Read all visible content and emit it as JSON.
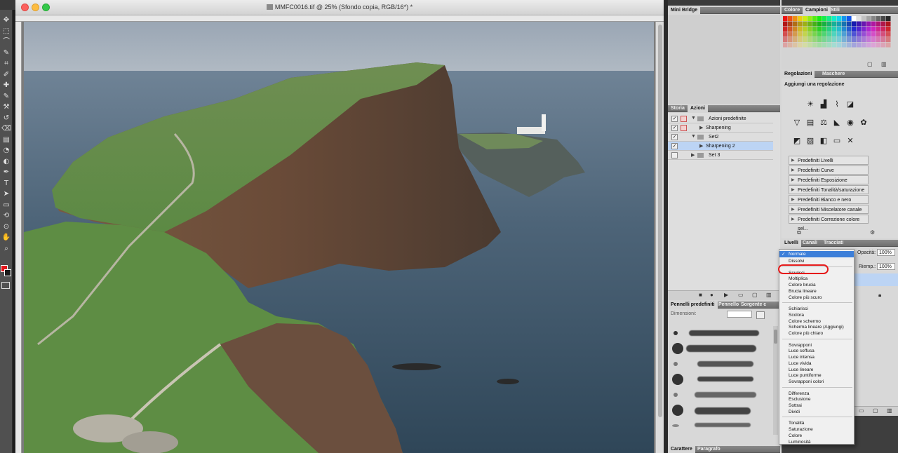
{
  "document": {
    "title": "MMFC0016.tif @ 25% (Sfondo copia, RGB/16*) *"
  },
  "panels": {
    "mini_bridge": {
      "tab": "Mini Bridge"
    },
    "color": {
      "tabs": [
        "Colore",
        "Campioni",
        "Stili"
      ]
    },
    "adjustments": {
      "tabs": [
        "Regolazioni",
        "Maschere"
      ],
      "heading": "Aggiungi una regolazione",
      "presets": [
        "Predefiniti Livelli",
        "Predefiniti Curve",
        "Predefiniti Esposizione",
        "Predefiniti Tonalità/saturazione",
        "Predefiniti Bianco e nero",
        "Predefiniti Miscelatore canale",
        "Predefiniti Correzione colore sel..."
      ]
    },
    "actions": {
      "tabs": [
        "Storia",
        "Azioni"
      ],
      "rows": [
        "Azioni predefinite",
        "Sharpening",
        "Set2",
        "Sharpening 2",
        "Set 3"
      ]
    },
    "layers": {
      "tabs": [
        "Livelli",
        "Canali",
        "Tracciati"
      ],
      "opacity_label": "Opacità:",
      "opacity_value": "100%",
      "fill_label": "Riemp.:",
      "fill_value": "100%"
    },
    "brushes": {
      "tabs": [
        "Pennelli predefiniti",
        "Pennello",
        "Sorgente c"
      ],
      "size_label": "Dimensioni:"
    },
    "character": {
      "tabs": [
        "Carattere",
        "Paragrafo"
      ]
    }
  },
  "blend_menu": {
    "checkmark": "✓",
    "groups": [
      [
        "Normale",
        "Dissolvi"
      ],
      [
        "Scurisci",
        "Moltiplica",
        "Colore brucia",
        "Brucia lineare",
        "Colore più scuro"
      ],
      [
        "Schiarisci",
        "Scolora",
        "Colore schermo",
        "Scherma lineare (Aggiungi)",
        "Colore più chiaro"
      ],
      [
        "Sovrapponi",
        "Luce soffusa",
        "Luce intensa",
        "Luce vivida",
        "Luce lineare",
        "Luce puntiforme",
        "Sovrapponi colori"
      ],
      [
        "Differenza",
        "Esclusione",
        "Sottrai",
        "Dividi"
      ],
      [
        "Tonalità",
        "Saturazione",
        "Colore",
        "Luminosità"
      ]
    ],
    "selected": "Normale",
    "highlighted": "Scurisci"
  },
  "colors": {
    "foreground": "#e3161b",
    "background": "#1a1a1a",
    "highlight_ring": "#e51a1a",
    "menu_selection": "#3d7fd9"
  },
  "icons": {
    "tools": [
      "move-icon",
      "marquee-icon",
      "lasso-icon",
      "quick-select-icon",
      "crop-icon",
      "eyedropper-icon",
      "healing-brush-icon",
      "brush-icon",
      "clone-stamp-icon",
      "history-brush-icon",
      "eraser-icon",
      "gradient-icon",
      "blur-icon",
      "dodge-icon",
      "pen-icon",
      "type-icon",
      "path-select-icon",
      "shape-icon",
      "3d-rotate-icon",
      "3d-orbit-icon",
      "hand-icon",
      "zoom-icon"
    ]
  }
}
